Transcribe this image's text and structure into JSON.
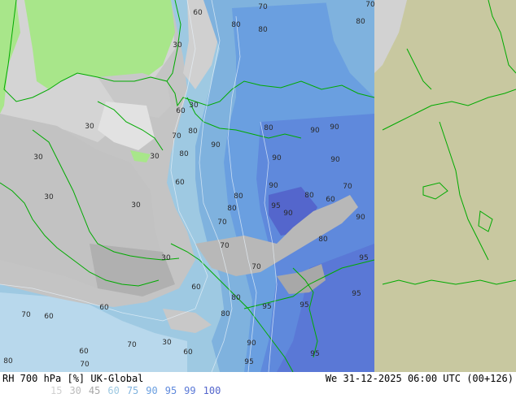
{
  "footer": {
    "title": "RH 700 hPa [%] UK-Global",
    "time": "We 31-12-2025 06:00 UTC (00+126)"
  },
  "legend": [
    {
      "label": "15",
      "color": "#d0d0d0"
    },
    {
      "label": "30",
      "color": "#bcbcbc"
    },
    {
      "label": "45",
      "color": "#a8a8a8"
    },
    {
      "label": "60",
      "color": "#9ec9e2"
    },
    {
      "label": "75",
      "color": "#7fb2de"
    },
    {
      "label": "90",
      "color": "#6a9fe0"
    },
    {
      "label": "95",
      "color": "#5f89dc"
    },
    {
      "label": "99",
      "color": "#5a78d6"
    },
    {
      "label": "100",
      "color": "#5466cc"
    }
  ],
  "colors": {
    "outside_domain": "#c8c8a0",
    "coastline": "#00aa00",
    "land_mask_green": "#a8e68a"
  },
  "contour_labels": [
    {
      "text": "60"
    },
    {
      "text": "70"
    },
    {
      "text": "70"
    },
    {
      "text": "80"
    },
    {
      "text": "80"
    },
    {
      "text": "80"
    },
    {
      "text": "30"
    },
    {
      "text": "30"
    },
    {
      "text": "60"
    },
    {
      "text": "30"
    },
    {
      "text": "80"
    },
    {
      "text": "70"
    },
    {
      "text": "90"
    },
    {
      "text": "80"
    },
    {
      "text": "90"
    },
    {
      "text": "90"
    },
    {
      "text": "80"
    },
    {
      "text": "90"
    },
    {
      "text": "90"
    },
    {
      "text": "30"
    },
    {
      "text": "30"
    },
    {
      "text": "60"
    },
    {
      "text": "30"
    },
    {
      "text": "30"
    },
    {
      "text": "80"
    },
    {
      "text": "90"
    },
    {
      "text": "80"
    },
    {
      "text": "60"
    },
    {
      "text": "70"
    },
    {
      "text": "80"
    },
    {
      "text": "95"
    },
    {
      "text": "90"
    },
    {
      "text": "90"
    },
    {
      "text": "70"
    },
    {
      "text": "70"
    },
    {
      "text": "80"
    },
    {
      "text": "30"
    },
    {
      "text": "95"
    },
    {
      "text": "70"
    },
    {
      "text": "60"
    },
    {
      "text": "80"
    },
    {
      "text": "95"
    },
    {
      "text": "95"
    },
    {
      "text": "95"
    },
    {
      "text": "60"
    },
    {
      "text": "70"
    },
    {
      "text": "60"
    },
    {
      "text": "70"
    },
    {
      "text": "30"
    },
    {
      "text": "60"
    },
    {
      "text": "90"
    },
    {
      "text": "95"
    },
    {
      "text": "60"
    },
    {
      "text": "70"
    },
    {
      "text": "80"
    },
    {
      "text": "95"
    },
    {
      "text": "80"
    }
  ]
}
